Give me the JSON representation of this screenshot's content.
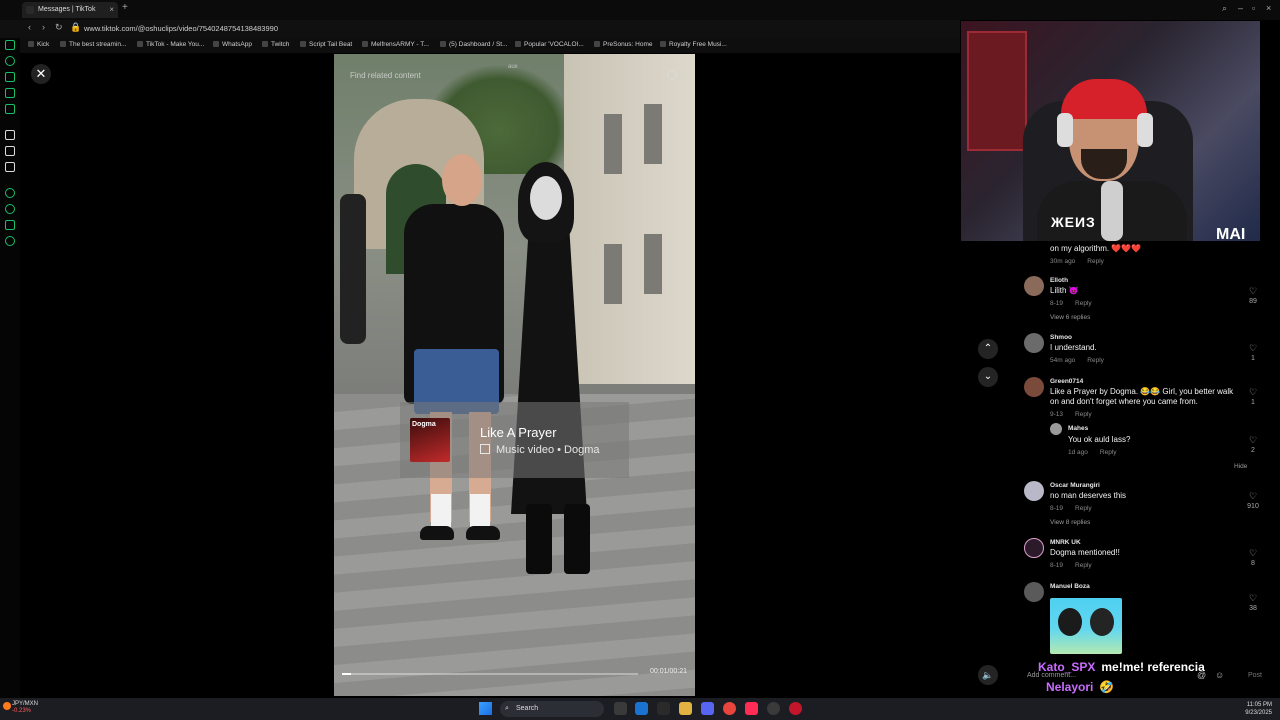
{
  "browser": {
    "tab_title": "Messages | TikTok",
    "url": "www.tiktok.com/@oshuclips/video/7540248754138483990",
    "bookmarks": [
      "Kick",
      "The best streamin...",
      "TikTok - Make You...",
      "WhatsApp",
      "Twitch",
      "Script Tail Beat",
      "MelfrensARMY - T...",
      "(5) Dashboard / St...",
      "Popular 'VOCALOI...",
      "PreSonus: Home",
      "Royalty Free Musi..."
    ]
  },
  "video": {
    "find_related": "Find related content",
    "tag": "aux",
    "progress_fraction": 0.03,
    "music_card": {
      "title": "Like A Prayer",
      "subtitle": "Music video • Dogma",
      "thumb_text": "Dogma"
    }
  },
  "webcam": {
    "shirt_text": "ЖЕИЗ",
    "watermark": "MAI"
  },
  "comments": {
    "partial_text": "on my algorithm. ❤️❤️❤️",
    "partial_meta": "30m ago",
    "items": [
      {
        "user": "Elloth",
        "text": "Lilith 😈",
        "meta": "8-19",
        "likes": "89",
        "replies": "View 6 replies"
      },
      {
        "user": "Shmoo",
        "text": "I understand.",
        "meta": "54m ago",
        "likes": "1",
        "replies": ""
      },
      {
        "user": "Green0714",
        "text": "Like a Prayer by Dogma. 😂😂 Girl, you better walk on and don't forget where you came from.",
        "meta": "9-13",
        "likes": "1",
        "replies": ""
      },
      {
        "user": "Mahes",
        "text": "You ok auld lass?",
        "meta": "1d ago",
        "likes": "2",
        "replies": ""
      },
      {
        "user": "Oscar Murangiri",
        "text": "no man deserves this",
        "meta": "8-19",
        "likes": "910",
        "replies": "View 8 replies"
      },
      {
        "user": "MNRK UK",
        "text": "Dogma mentioned!!",
        "meta": "8-19",
        "likes": "8",
        "replies": ""
      },
      {
        "user": "Manuel Boza",
        "text": "",
        "meta": "",
        "likes": "38",
        "replies": ""
      }
    ],
    "reply_label": "Reply",
    "hide_label": "Hide",
    "add_comment_placeholder": "Add comment...",
    "post_label": "Post"
  },
  "chat_overlay": [
    {
      "name": "Kato_SPX",
      "message": "me!me! referencia"
    },
    {
      "name": "Nelayori",
      "message": "🤣"
    }
  ],
  "taskbar": {
    "ticker_pair": "JPY/MXN",
    "ticker_change": "-0.23%",
    "search_label": "Search",
    "time": "11:05 PM",
    "date": "9/23/2025"
  },
  "colors": {
    "rail_accent": "#1bbf6a",
    "chat_name": "#c96cff",
    "tab_active": "#1f1f1f"
  }
}
